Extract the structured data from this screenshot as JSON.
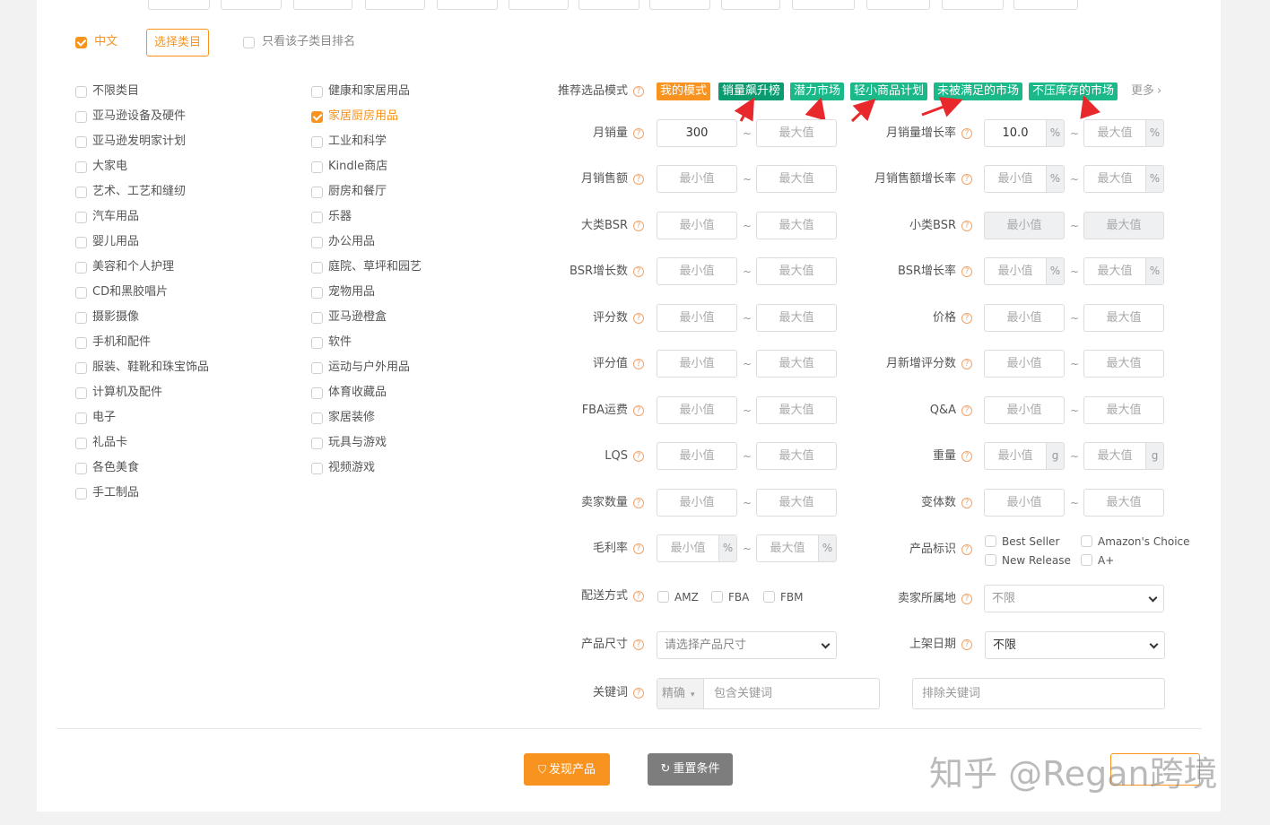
{
  "colors": {
    "accent": "#f7931e",
    "tag_green": "#1bb88a",
    "tag_green_dark": "#0b9b70",
    "arrow_red": "#e8282b",
    "reset_gray": "#7d7d7d"
  },
  "top_options": {
    "lang_label": "中文",
    "select_category_button": "选择类目",
    "only_subcategory_label": "只看该子类目排名"
  },
  "categories_col1": [
    {
      "label": "不限类目",
      "checked": false
    },
    {
      "label": "亚马逊设备及硬件",
      "checked": false
    },
    {
      "label": "亚马逊发明家计划",
      "checked": false
    },
    {
      "label": "大家电",
      "checked": false
    },
    {
      "label": "艺术、工艺和缝纫",
      "checked": false
    },
    {
      "label": "汽车用品",
      "checked": false
    },
    {
      "label": "婴儿用品",
      "checked": false
    },
    {
      "label": "美容和个人护理",
      "checked": false
    },
    {
      "label": "CD和黑胶唱片",
      "checked": false
    },
    {
      "label": "摄影摄像",
      "checked": false
    },
    {
      "label": "手机和配件",
      "checked": false
    },
    {
      "label": "服装、鞋靴和珠宝饰品",
      "checked": false
    },
    {
      "label": "计算机及配件",
      "checked": false
    },
    {
      "label": "电子",
      "checked": false
    },
    {
      "label": "礼品卡",
      "checked": false
    },
    {
      "label": "各色美食",
      "checked": false
    },
    {
      "label": "手工制品",
      "checked": false
    }
  ],
  "categories_col2": [
    {
      "label": "健康和家居用品",
      "checked": false
    },
    {
      "label": "家居厨房用品",
      "checked": true
    },
    {
      "label": "工业和科学",
      "checked": false
    },
    {
      "label": "Kindle商店",
      "checked": false
    },
    {
      "label": "厨房和餐厅",
      "checked": false
    },
    {
      "label": "乐器",
      "checked": false
    },
    {
      "label": "办公用品",
      "checked": false
    },
    {
      "label": "庭院、草坪和园艺",
      "checked": false
    },
    {
      "label": "宠物用品",
      "checked": false
    },
    {
      "label": "亚马逊橙盒",
      "checked": false
    },
    {
      "label": "软件",
      "checked": false
    },
    {
      "label": "运动与户外用品",
      "checked": false
    },
    {
      "label": "体育收藏品",
      "checked": false
    },
    {
      "label": "家居装修",
      "checked": false
    },
    {
      "label": "玩具与游戏",
      "checked": false
    },
    {
      "label": "视频游戏",
      "checked": false
    }
  ],
  "mode": {
    "label": "推荐选品模式",
    "tags": [
      "我的模式",
      "销量飙升榜",
      "潜力市场",
      "轻小商品计划",
      "未被满足的市场",
      "不压库存的市场"
    ],
    "more": "更多"
  },
  "placeholders": {
    "min": "最小值",
    "max": "最大值"
  },
  "fields_left": [
    {
      "label": "月销量",
      "min": "300",
      "suffix": ""
    },
    {
      "label": "月销售额",
      "min": "",
      "suffix": ""
    },
    {
      "label": "大类BSR",
      "min": "",
      "suffix": ""
    },
    {
      "label": "BSR增长数",
      "min": "",
      "suffix": ""
    },
    {
      "label": "评分数",
      "min": "",
      "suffix": ""
    },
    {
      "label": "评分值",
      "min": "",
      "suffix": ""
    },
    {
      "label": "FBA运费",
      "min": "",
      "suffix": ""
    },
    {
      "label": "LQS",
      "min": "",
      "suffix": ""
    },
    {
      "label": "卖家数量",
      "min": "",
      "suffix": ""
    },
    {
      "label": "毛利率",
      "min": "",
      "suffix": "%"
    }
  ],
  "fields_right": [
    {
      "label": "月销量增长率",
      "min": "10.0",
      "suffix": "%"
    },
    {
      "label": "月销售额增长率",
      "min": "",
      "suffix": "%"
    },
    {
      "label": "小类BSR",
      "min": "",
      "suffix": ""
    },
    {
      "label": "BSR增长率",
      "min": "",
      "suffix": "%"
    },
    {
      "label": "价格",
      "min": "",
      "suffix": ""
    },
    {
      "label": "月新增评分数",
      "min": "",
      "suffix": ""
    },
    {
      "label": "Q&A",
      "min": "",
      "suffix": ""
    },
    {
      "label": "重量",
      "min": "",
      "suffix": "g"
    },
    {
      "label": "变体数",
      "min": "",
      "suffix": ""
    }
  ],
  "product_badge": {
    "label": "产品标识",
    "options": [
      "Best Seller",
      "Amazon's Choice",
      "New Release",
      "A+"
    ]
  },
  "delivery": {
    "label": "配送方式",
    "options": [
      "AMZ",
      "FBA",
      "FBM"
    ]
  },
  "seller_location": {
    "label": "卖家所属地",
    "value": "不限"
  },
  "product_size": {
    "label": "产品尺寸",
    "value": "请选择产品尺寸"
  },
  "listing_date": {
    "label": "上架日期",
    "value": "不限"
  },
  "keyword": {
    "label": "关键词",
    "match_mode": "精确",
    "include_placeholder": "包含关键词",
    "exclude_placeholder": "排除关键词"
  },
  "buttons": {
    "discover": "发现产品",
    "reset": "重置条件"
  },
  "watermark": "知乎 @Regan跨境"
}
